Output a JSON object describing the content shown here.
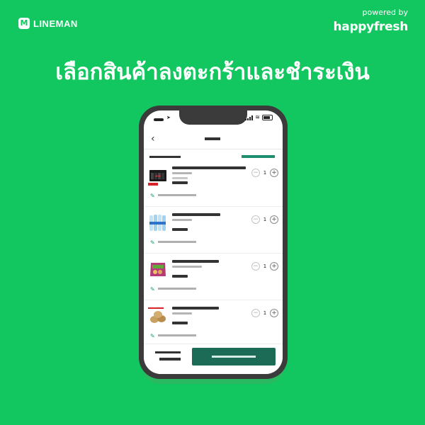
{
  "brand": {
    "badge": "M",
    "name": "LINEMAN"
  },
  "powered_by": {
    "label": "powered by",
    "logo": "happyfresh"
  },
  "headline": "เลือกสินค้าลงตะกร้าและชำระเงิน",
  "colors": {
    "background": "#12c760",
    "checkout_button": "#1b6b56",
    "accent_link": "#1e8f6e",
    "phone_body": "#3b3b3b"
  },
  "icons": {
    "back": "back-arrow-icon",
    "edit_note": "pencil-icon",
    "minus": "minus-icon",
    "plus": "plus-icon"
  },
  "cart_items": [
    {
      "product": "energy-drink-pack",
      "quantity": "1",
      "sale_tag": true
    },
    {
      "product": "water-bottle-pack",
      "quantity": "1"
    },
    {
      "product": "dried-fruit-bag",
      "quantity": "1"
    },
    {
      "product": "potatoes",
      "quantity": "1"
    }
  ],
  "stepper": {
    "minus": "−",
    "plus": "+"
  }
}
